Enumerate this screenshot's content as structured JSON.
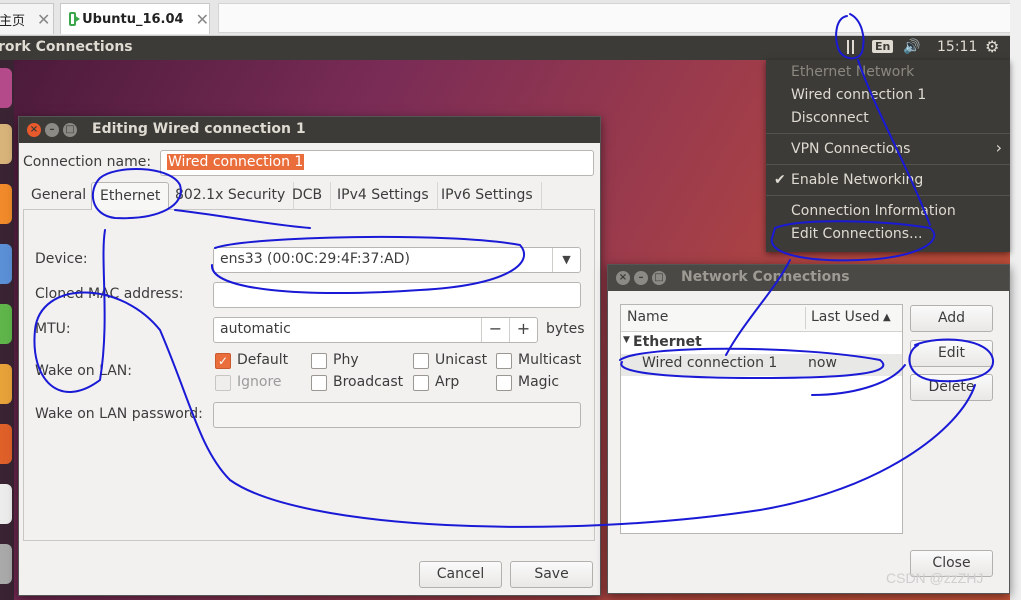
{
  "browser": {
    "tabs": [
      {
        "label": "主页"
      },
      {
        "label": "Ubuntu_16.04"
      }
    ],
    "close_glyph": "✕"
  },
  "panel": {
    "title": "rork Connections",
    "lang": "En",
    "clock": "15:11",
    "volume_icon": "speaker-icon",
    "gear_icon": "gear-icon"
  },
  "indicator_menu": {
    "header": "Ethernet Network",
    "wired": "Wired connection 1",
    "disconnect": "Disconnect",
    "vpn": "VPN Connections",
    "enable_networking": "Enable Networking",
    "connection_information": "Connection Information",
    "edit_connections": "Edit Connections..."
  },
  "editing_dialog": {
    "title": "Editing Wired connection 1",
    "connection_name_label": "Connection name:",
    "connection_name_value": "Wired connection 1",
    "tabs": [
      {
        "label": "General"
      },
      {
        "label": "Ethernet"
      },
      {
        "label": "802.1x Security"
      },
      {
        "label": "DCB"
      },
      {
        "label": "IPv4 Settings"
      },
      {
        "label": "IPv6 Settings"
      }
    ],
    "active_tab": "Ethernet",
    "device_label": "Device:",
    "device_value": "ens33 (00:0C:29:4F:37:AD)",
    "cloned_mac_label": "Cloned MAC address:",
    "cloned_mac_value": "",
    "mtu_label": "MTU:",
    "mtu_value": "automatic",
    "mtu_minus": "−",
    "mtu_plus": "+",
    "mtu_unit": "bytes",
    "wol_label": "Wake on LAN:",
    "wol_options": [
      {
        "label": "Default",
        "checked": true,
        "disabled": false
      },
      {
        "label": "Phy",
        "checked": false,
        "disabled": false
      },
      {
        "label": "Unicast",
        "checked": false,
        "disabled": false
      },
      {
        "label": "Multicast",
        "checked": false,
        "disabled": false
      },
      {
        "label": "Ignore",
        "checked": false,
        "disabled": true
      },
      {
        "label": "Broadcast",
        "checked": false,
        "disabled": false
      },
      {
        "label": "Arp",
        "checked": false,
        "disabled": false
      },
      {
        "label": "Magic",
        "checked": false,
        "disabled": false
      }
    ],
    "wol_password_label": "Wake on LAN password:",
    "wol_password_value": "",
    "cancel": "Cancel",
    "save": "Save"
  },
  "network_dialog": {
    "title": "Network Connections",
    "col_name": "Name",
    "col_last_used": "Last Used",
    "group": "Ethernet",
    "row_name": "Wired connection 1",
    "row_last_used": "now",
    "add": "Add",
    "edit": "Edit",
    "delete": "Delete",
    "close": "Close"
  },
  "colors": {
    "accent": "#e96e3c",
    "panel": "#3c3b37",
    "annotation": "#1a1ad6"
  },
  "watermark": "CSDN @zzZHJ"
}
